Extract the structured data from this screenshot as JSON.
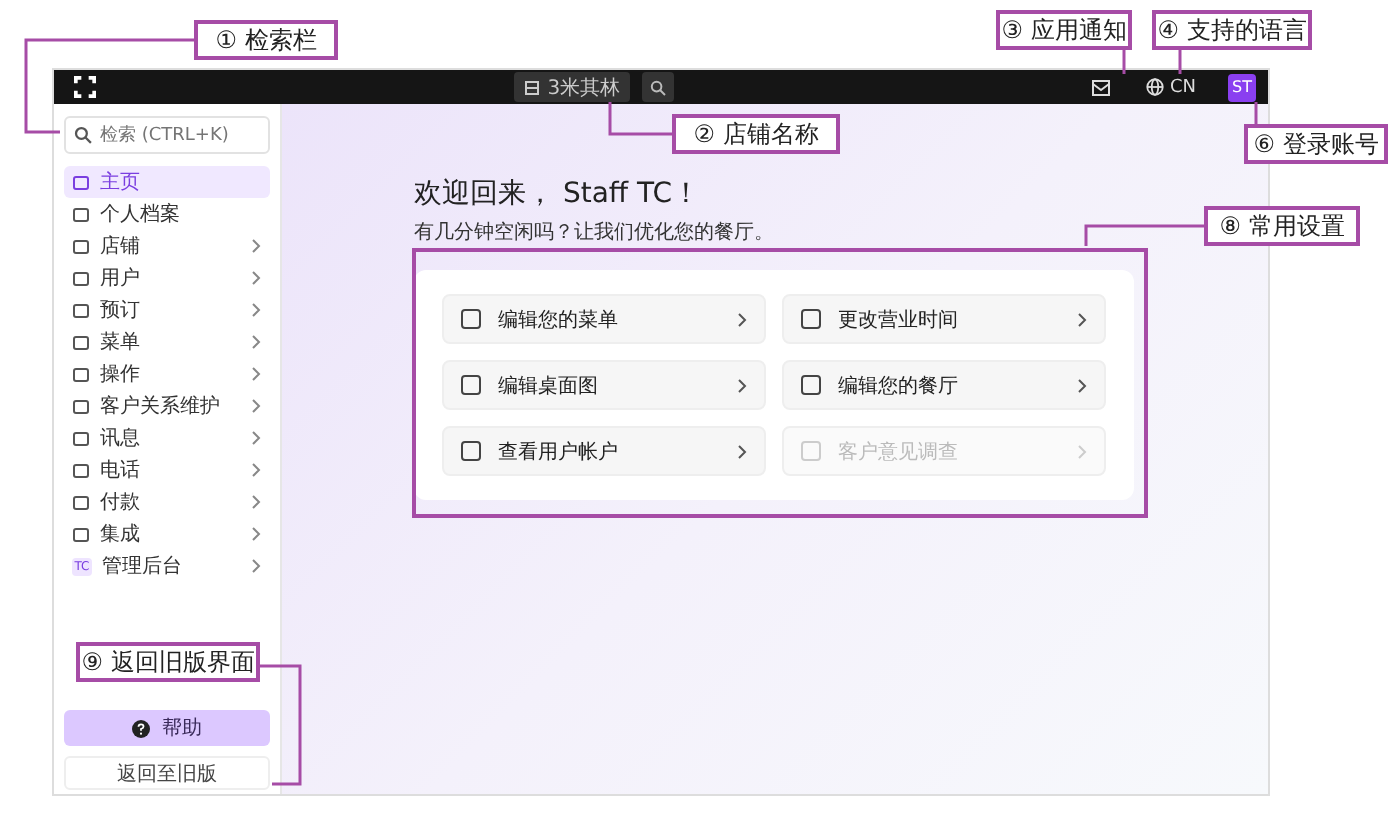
{
  "topbar": {
    "store_name": "3米其林",
    "language": "CN",
    "avatar": "ST"
  },
  "sidebar": {
    "search": {
      "placeholder": "检索 (CTRL+K)"
    },
    "items": [
      {
        "label": "主页",
        "selected": true,
        "expandable": false
      },
      {
        "label": "个人档案",
        "selected": false,
        "expandable": false
      },
      {
        "label": "店铺",
        "selected": false,
        "expandable": true
      },
      {
        "label": "用户",
        "selected": false,
        "expandable": true
      },
      {
        "label": "预订",
        "selected": false,
        "expandable": true
      },
      {
        "label": "菜单",
        "selected": false,
        "expandable": true
      },
      {
        "label": "操作",
        "selected": false,
        "expandable": true
      },
      {
        "label": "客户关系维护",
        "selected": false,
        "expandable": true
      },
      {
        "label": "讯息",
        "selected": false,
        "expandable": true
      },
      {
        "label": "电话",
        "selected": false,
        "expandable": true
      },
      {
        "label": "付款",
        "selected": false,
        "expandable": true
      },
      {
        "label": "集成",
        "selected": false,
        "expandable": true
      },
      {
        "label": "管理后台",
        "selected": false,
        "expandable": true,
        "badge": "TC"
      }
    ],
    "help_button": "帮助",
    "legacy_button": "返回至旧版"
  },
  "main": {
    "title": "欢迎回来， Staff TC！",
    "subtitle": "有几分钟空闲吗？让我们优化您的餐厅。",
    "shortcuts": [
      {
        "label": "编辑您的菜单",
        "disabled": false
      },
      {
        "label": "更改营业时间",
        "disabled": false
      },
      {
        "label": "编辑桌面图",
        "disabled": false
      },
      {
        "label": "编辑您的餐厅",
        "disabled": false
      },
      {
        "label": "查看用户帐户",
        "disabled": false
      },
      {
        "label": "客户意见调查",
        "disabled": true
      }
    ]
  },
  "annotations": [
    {
      "label": "① 检索栏"
    },
    {
      "label": "② 店铺名称"
    },
    {
      "label": "③ 应用通知"
    },
    {
      "label": "④ 支持的语言"
    },
    {
      "label": "⑥ 登录账号"
    },
    {
      "label": "⑧ 常用设置"
    },
    {
      "label": "⑨ 返回旧版界面"
    }
  ]
}
